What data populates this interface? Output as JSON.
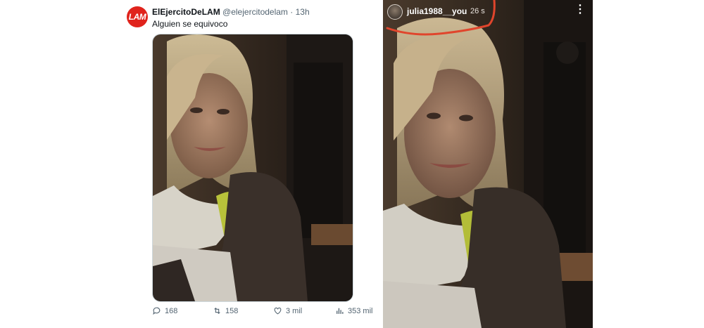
{
  "tweet": {
    "avatar_text": "LAM",
    "display_name": "ElEjercitoDeLAM",
    "handle": "@elejercitodelam",
    "separator": "·",
    "time": "13h",
    "text": "Alguien se equivoco",
    "stats": {
      "replies": "168",
      "retweets": "158",
      "likes": "3 mil",
      "views": "353 mil"
    },
    "icons": [
      "reply-icon",
      "retweet-icon",
      "like-icon",
      "views-icon"
    ]
  },
  "story": {
    "username": "julia1988__you",
    "time": "26 s",
    "menu_icon": "more-vertical-icon",
    "annotation_color": "#e0452c"
  },
  "colors": {
    "brand_red": "#e0231c",
    "text_primary": "#0f1419",
    "text_secondary": "#536471"
  }
}
